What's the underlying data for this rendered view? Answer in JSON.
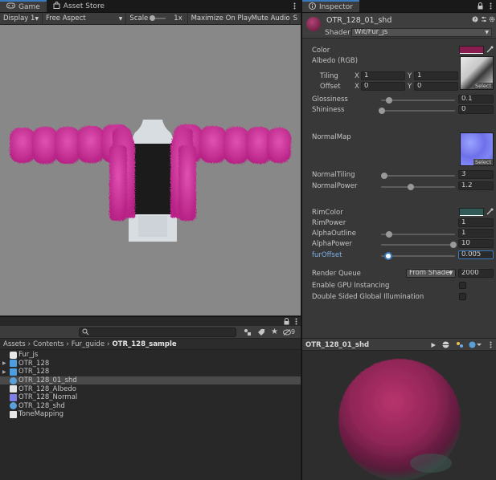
{
  "game_view": {
    "tabs": [
      {
        "label": "Game",
        "icon": "gamepad-icon"
      },
      {
        "label": "Asset Store",
        "icon": "store-bag-icon"
      }
    ],
    "toolbar": {
      "display": "Display 1",
      "aspect": "Free Aspect",
      "scale_label": "Scale",
      "scale_value": "1x",
      "maximize": "Maximize On Play",
      "mute": "Mute Audio",
      "stats_cut": "S"
    },
    "scene_colors": {
      "fur": "#d6389f",
      "background": "#888888",
      "shirt": "#1b1b1b",
      "mannequin": "#d8dde2"
    }
  },
  "project": {
    "search_placeholder": "",
    "hidden_count": "9",
    "breadcrumb": [
      "Assets",
      "Contents",
      "Fur_guide",
      "OTR_128_sample"
    ],
    "files": [
      {
        "name": "Fur_js",
        "icon": "shader-icon",
        "foldout": false,
        "selected": false
      },
      {
        "name": "OTR_128",
        "icon": "prefab-icon",
        "foldout": true,
        "selected": false
      },
      {
        "name": "OTR_128",
        "icon": "prefab-icon",
        "foldout": true,
        "selected": false
      },
      {
        "name": "OTR_128_01_shd",
        "icon": "material-icon",
        "foldout": false,
        "selected": true
      },
      {
        "name": "OTR_128_Albedo",
        "icon": "texture-icon",
        "foldout": false,
        "selected": false
      },
      {
        "name": "OTR_128_Normal",
        "icon": "normalmap-icon",
        "foldout": false,
        "selected": false
      },
      {
        "name": "OTR_128_shd",
        "icon": "material-icon",
        "foldout": false,
        "selected": false
      },
      {
        "name": "ToneMapping",
        "icon": "script-icon",
        "foldout": false,
        "selected": false
      }
    ]
  },
  "inspector": {
    "tab_label": "Inspector",
    "material_name": "OTR_128_01_shd",
    "shader_label": "Shader",
    "shader_value": "Wit/Fur_js",
    "color_label": "Color",
    "color_value": "#8a1d4f",
    "albedo_label": "Albedo (RGB)",
    "tiling_label": "Tiling",
    "offset_label": "Offset",
    "tiling": {
      "x": "1",
      "y": "1"
    },
    "offset": {
      "x": "0",
      "y": "0"
    },
    "axis_x": "X",
    "axis_y": "Y",
    "select_label": "Select",
    "glossiness": {
      "label": "Glossiness",
      "value": "0.1",
      "fraction": 0.1
    },
    "shininess": {
      "label": "Shininess",
      "value": "0",
      "fraction": 0.0
    },
    "normalmap_label": "NormalMap",
    "normal_tiling": {
      "label": "NormalTiling",
      "value": "3",
      "fraction": 0.06
    },
    "normal_power": {
      "label": "NormalPower",
      "value": "1.2",
      "fraction": 0.4
    },
    "rim_color_label": "RimColor",
    "rim_color_value": "#2f5a55",
    "rim_power": {
      "label": "RimPower",
      "value": "1"
    },
    "alpha_outline": {
      "label": "AlphaOutline",
      "value": "1",
      "fraction": 0.1
    },
    "alpha_power": {
      "label": "AlphaPower",
      "value": "10",
      "fraction": 1.0
    },
    "fur_offset": {
      "label": "furOffset",
      "value": "0.005",
      "fraction": 0.1
    },
    "render_queue": {
      "label": "Render Queue",
      "mode": "From Shader",
      "value": "2000"
    },
    "gpu_instancing_label": "Enable GPU Instancing",
    "double_sided_label": "Double Sided Global Illumination"
  },
  "preview": {
    "title": "OTR_128_01_shd",
    "sphere_color": "#9b2a5c"
  },
  "accent_color": "#3a79bb"
}
